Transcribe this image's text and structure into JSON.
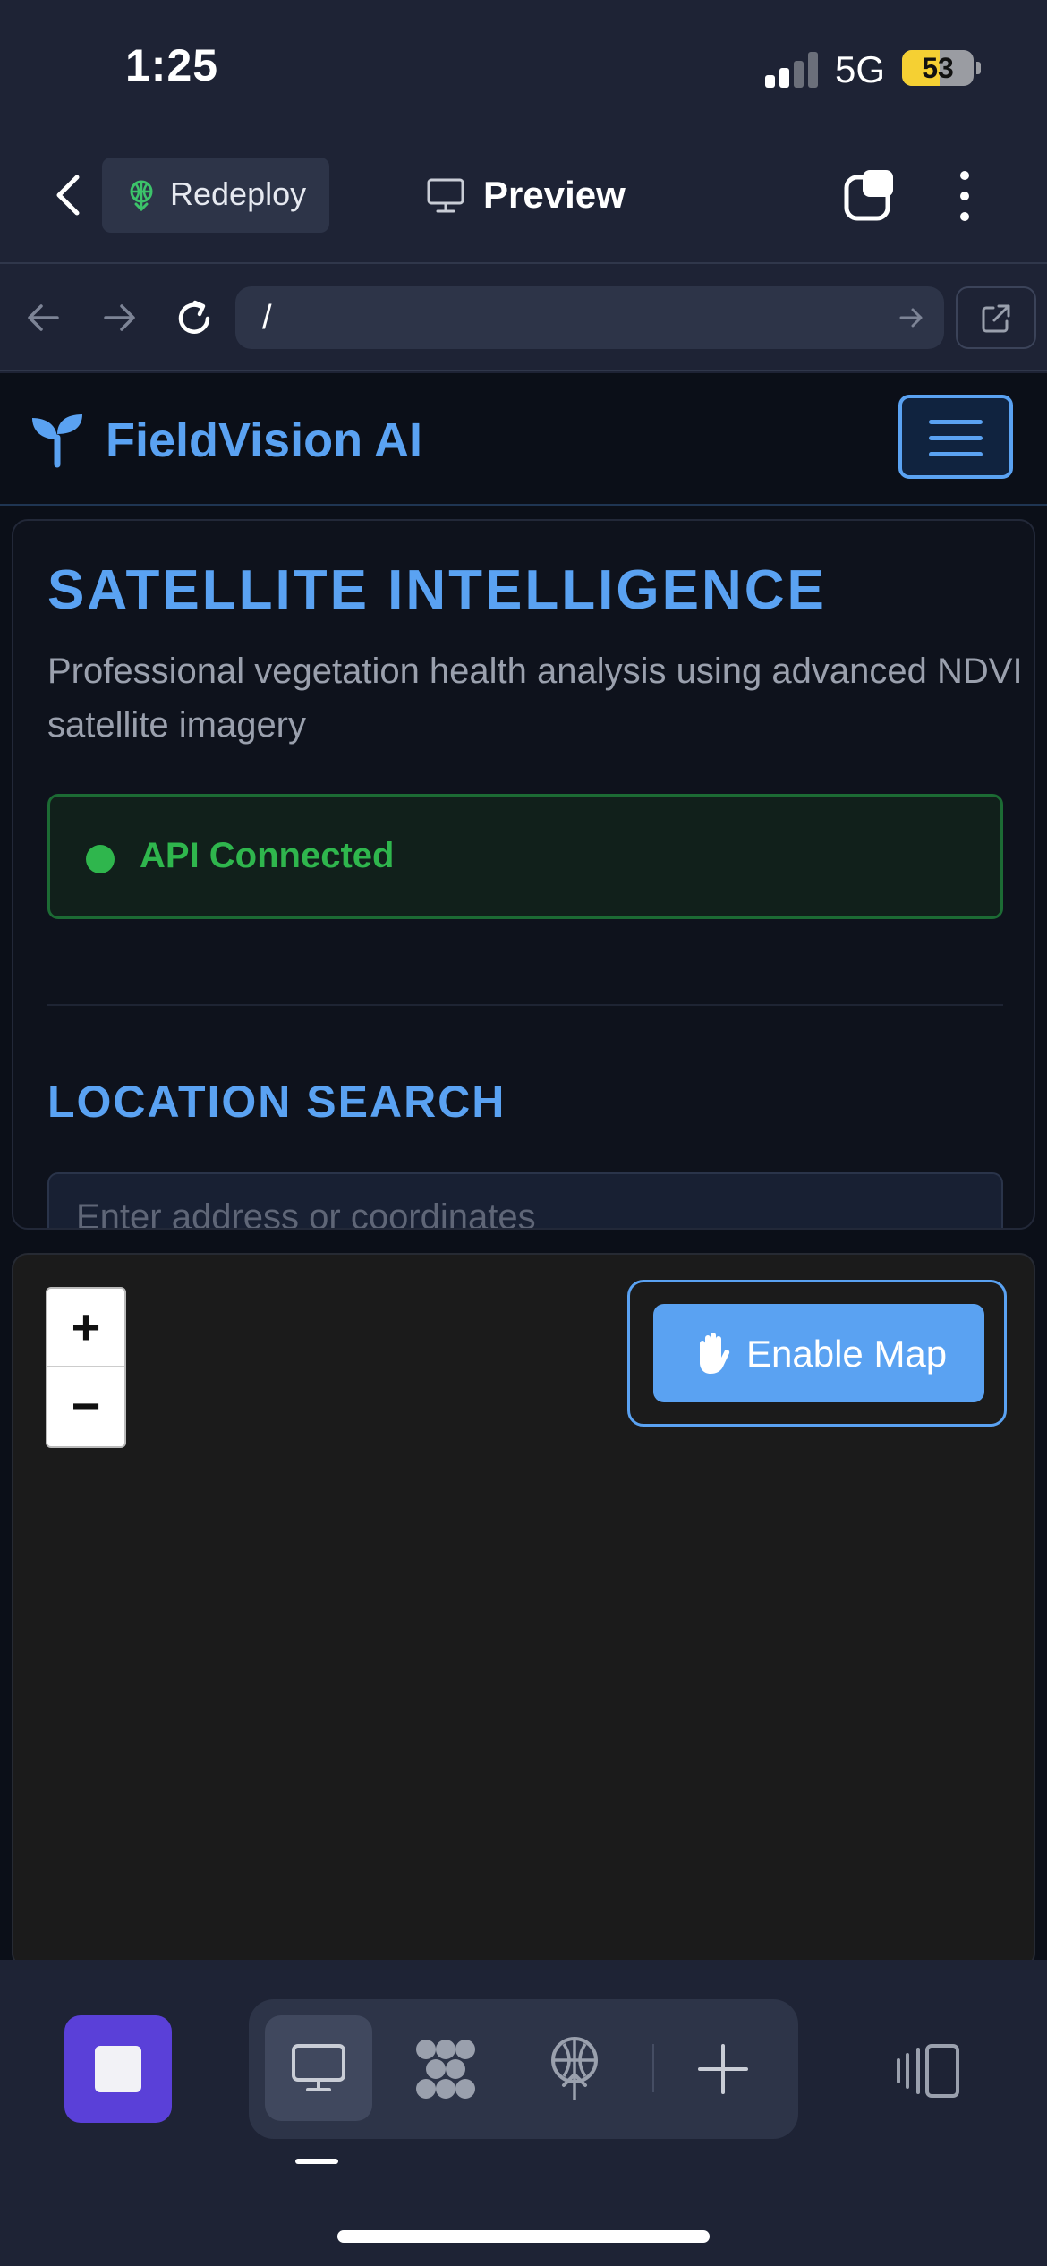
{
  "status_bar": {
    "time": "1:25",
    "network": "5G",
    "battery": "53",
    "battery_level_percent": 53,
    "signal_bars_filled": 2
  },
  "app_header": {
    "redeploy_label": "Redeploy",
    "preview_label": "Preview"
  },
  "browser": {
    "url": "/"
  },
  "site": {
    "brand_name": "FieldVision AI",
    "panel": {
      "title": "SATELLITE INTELLIGENCE",
      "subtitle": "Professional vegetation health analysis using advanced NDVI satellite imagery",
      "api_status": "API Connected",
      "section_title": "LOCATION SEARCH",
      "search_placeholder": "Enter address or coordinates"
    },
    "map": {
      "zoom_in": "+",
      "zoom_out": "−",
      "enable_map_label": "Enable Map"
    }
  },
  "colors": {
    "accent": "#5aa2f2",
    "success": "#2fb64d",
    "app_bg": "#1e2335",
    "site_bg": "#0b0f18",
    "stop_button": "#5a40d8"
  },
  "icons": [
    "back-icon",
    "sprout-icon",
    "monitor-icon",
    "tabs-icon",
    "more-vertical-icon",
    "arrow-left-icon",
    "arrow-right-icon",
    "reload-icon",
    "go-arrow-icon",
    "external-link-icon",
    "menu-icon",
    "hand-icon",
    "stop-icon",
    "workflow-icon",
    "deploy-icon",
    "plus-icon",
    "layout-icon"
  ]
}
